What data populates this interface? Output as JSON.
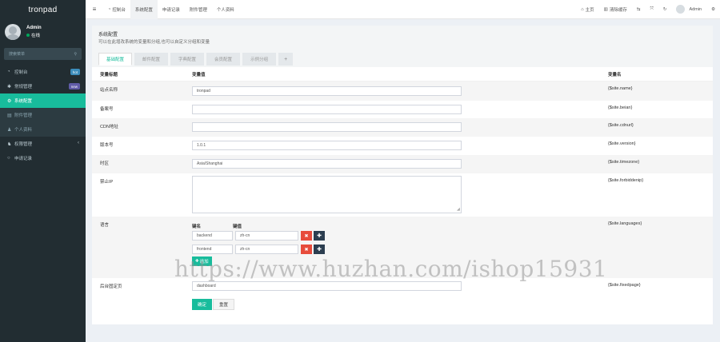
{
  "app": {
    "logo": "tronpad"
  },
  "user": {
    "name": "Admin",
    "status": "在线"
  },
  "sidebar": {
    "search_placeholder": "搜索菜单",
    "items": [
      {
        "label": "控制台",
        "icon": "dashboard-icon",
        "badge": "hot",
        "badge_color": "#3c8dbc"
      },
      {
        "label": "常规管理",
        "icon": "cogs-icon",
        "badge": "new",
        "badge_color": "#605ca8"
      },
      {
        "label": "系统配置",
        "icon": "gear-icon",
        "active": true
      },
      {
        "label": "附件管理",
        "icon": "file-icon"
      },
      {
        "label": "个人资料",
        "icon": "user-icon"
      },
      {
        "label": "权限管理",
        "icon": "group-icon"
      },
      {
        "label": "申请记录",
        "icon": "circle-icon"
      }
    ]
  },
  "topbar": {
    "tabs": [
      "控制台",
      "系统配置",
      "申请记录",
      "附件管理",
      "个人资料"
    ],
    "right": {
      "home": "主页",
      "clear_cache": "清除缓存",
      "username": "Admin"
    }
  },
  "panel": {
    "title": "系统配置",
    "description": "可以在此增改系统的变量和分组,也可以自定义分组和变量",
    "tabs": [
      "基础配置",
      "邮件配置",
      "字典配置",
      "会员配置",
      "示例分组"
    ],
    "columns": {
      "title": "变量标题",
      "value": "变量值",
      "name": "变量名"
    },
    "rows": [
      {
        "label": "站点名称",
        "value": "tronpad",
        "var": "{$site.name}"
      },
      {
        "label": "备案号",
        "value": "",
        "var": "{$site.beian}"
      },
      {
        "label": "CDN地址",
        "value": "",
        "var": "{$site.cdnurl}"
      },
      {
        "label": "版本号",
        "value": "1.0.1",
        "var": "{$site.version}"
      },
      {
        "label": "时区",
        "value": "Asia/Shanghai",
        "var": "{$site.timezone}"
      },
      {
        "label": "禁止IP",
        "value": "",
        "var": "{$site.forbiddenip}"
      },
      {
        "label": "语言",
        "var": "{$site.languages}"
      },
      {
        "label": "后台固定页",
        "value": "dashboard",
        "var": "{$site.fixedpage}"
      }
    ],
    "languages": {
      "key_header": "键名",
      "value_header": "键值",
      "items": [
        {
          "key": "backend",
          "value": "zh-cn"
        },
        {
          "key": "frontend",
          "value": "zh-cn"
        }
      ],
      "add_label": "追加"
    },
    "buttons": {
      "ok": "确定",
      "reset": "重置"
    }
  },
  "watermark": "https://www.huzhan.com/ishop15931"
}
